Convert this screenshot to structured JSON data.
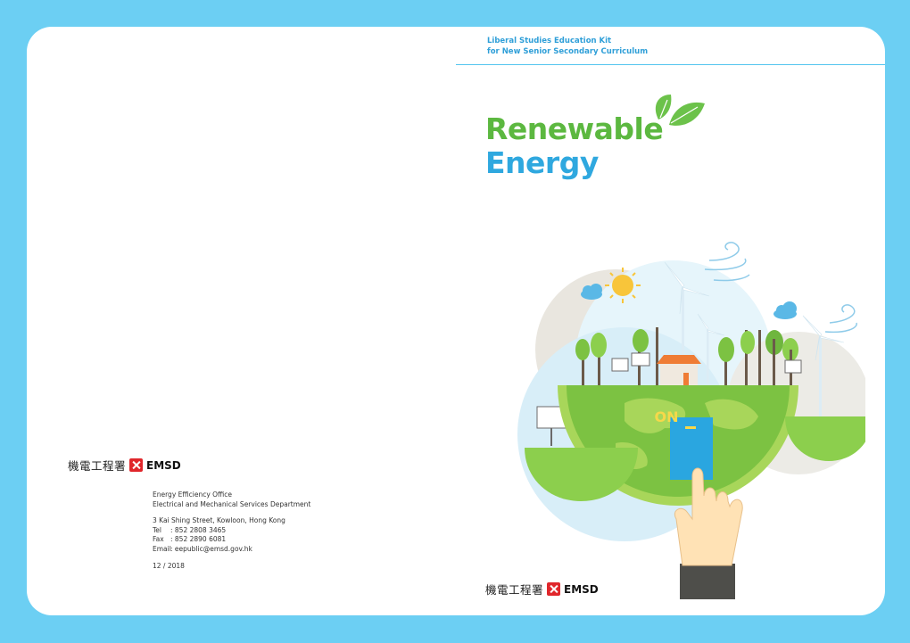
{
  "left_cover": {
    "logo": {
      "chinese": "機電工程署",
      "english": "EMSD"
    },
    "contact": {
      "office": "Energy Efficiency Office",
      "department": "Electrical and Mechanical Services Department",
      "address": "3 Kai Shing Street, Kowloon, Hong Kong",
      "tel_label": "Tel",
      "tel": ": 852 2808 3465",
      "fax_label": "Fax",
      "fax": ": 852 2890 6081",
      "email_label": "Email",
      "email": ": eepublic@emsd.gov.hk"
    },
    "issue_date": "12 / 2018"
  },
  "right_cover": {
    "kit_title_line1": "Liberal Studies Education Kit",
    "kit_title_line2": "for New Senior Secondary Curriculum",
    "title_line1": "Renewable",
    "title_line2": "Energy",
    "switch_label": "ON",
    "logo": {
      "chinese": "機電工程署",
      "english": "EMSD"
    }
  },
  "colors": {
    "frame": "#6ccff3",
    "title_green": "#5cb840",
    "title_blue": "#2fa8df",
    "emsd_red": "#e0262b"
  },
  "icons": [
    "leaf-icon",
    "sun-icon",
    "cloud-icon",
    "wind-icon",
    "wind-turbine-icon",
    "solar-panel-icon",
    "tree-icon",
    "house-icon",
    "globe-icon",
    "hand-icon",
    "switch-icon"
  ]
}
